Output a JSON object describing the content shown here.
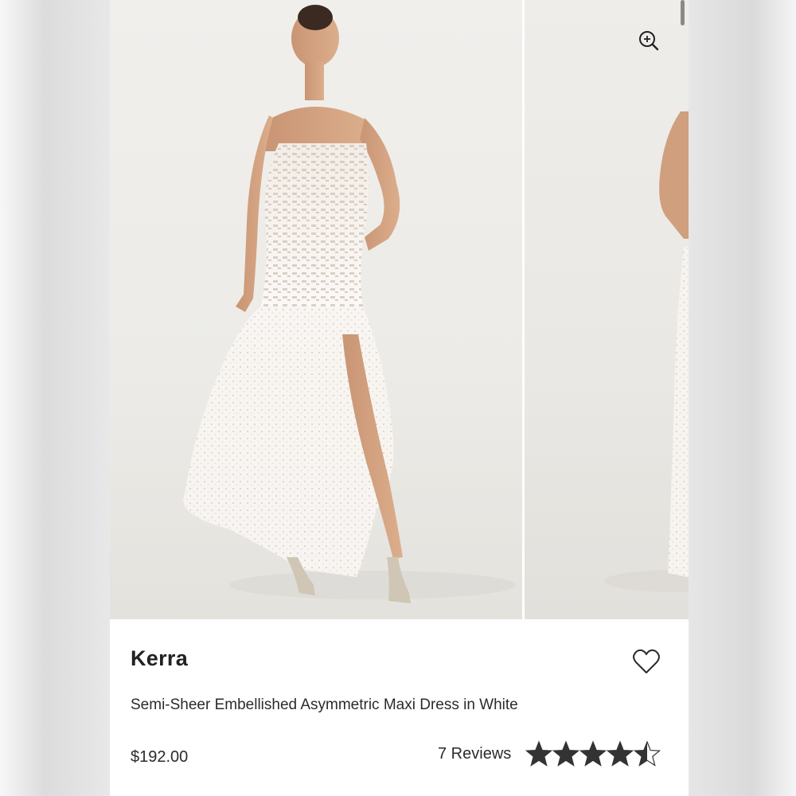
{
  "product": {
    "brand": "Kerra",
    "name": "Semi-Sheer Embellished Asymmetric Maxi Dress in White",
    "price": "$192.00",
    "reviews_label": "7 Reviews",
    "rating": 4.5,
    "rating_max": 5
  },
  "gallery": {
    "images": [
      {
        "alt": "Model wearing strapless embellished maxi dress, front view"
      },
      {
        "alt": "Model wearing dress, side view (partially visible)"
      }
    ]
  },
  "icons": {
    "zoom": "zoom-in-icon",
    "favorite": "heart-outline-icon",
    "star": "star-icon"
  },
  "colors": {
    "text": "#2b2b2b",
    "star": "#333333",
    "card_bg": "#ffffff",
    "photo_bg": "#efedea"
  }
}
